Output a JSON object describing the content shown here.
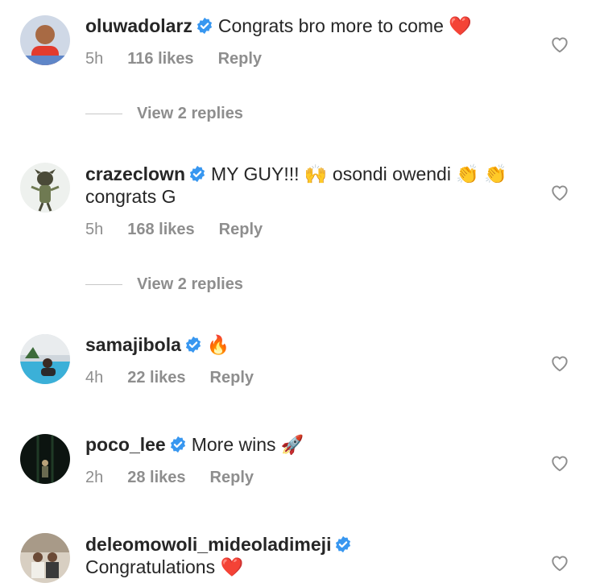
{
  "comments": [
    {
      "username": "oluwadolarz",
      "text": "Congrats bro more to come",
      "emoji": "❤️",
      "time": "5h",
      "likes": "116 likes",
      "reply": "Reply",
      "view_replies": "View 2 replies"
    },
    {
      "username": "crazeclown",
      "text": "MY GUY!!! 🙌 osondi owendi 👏 👏 congrats G",
      "time": "5h",
      "likes": "168 likes",
      "reply": "Reply",
      "view_replies": "View 2 replies"
    },
    {
      "username": "samajibola",
      "emoji": "🔥",
      "time": "4h",
      "likes": "22 likes",
      "reply": "Reply"
    },
    {
      "username": "poco_lee",
      "text": "More wins",
      "emoji": "🚀",
      "time": "2h",
      "likes": "28 likes",
      "reply": "Reply"
    },
    {
      "username": "deleomowoli_mideoladimeji",
      "text": "Congratulations",
      "emoji": "❤️"
    }
  ],
  "colors": {
    "verified": "#3897f0",
    "meta": "#8e8e8e",
    "text": "#262626",
    "heart_red": "#ed4956"
  },
  "icons": {
    "verified": "verified-badge-icon",
    "like": "heart-outline-icon"
  }
}
